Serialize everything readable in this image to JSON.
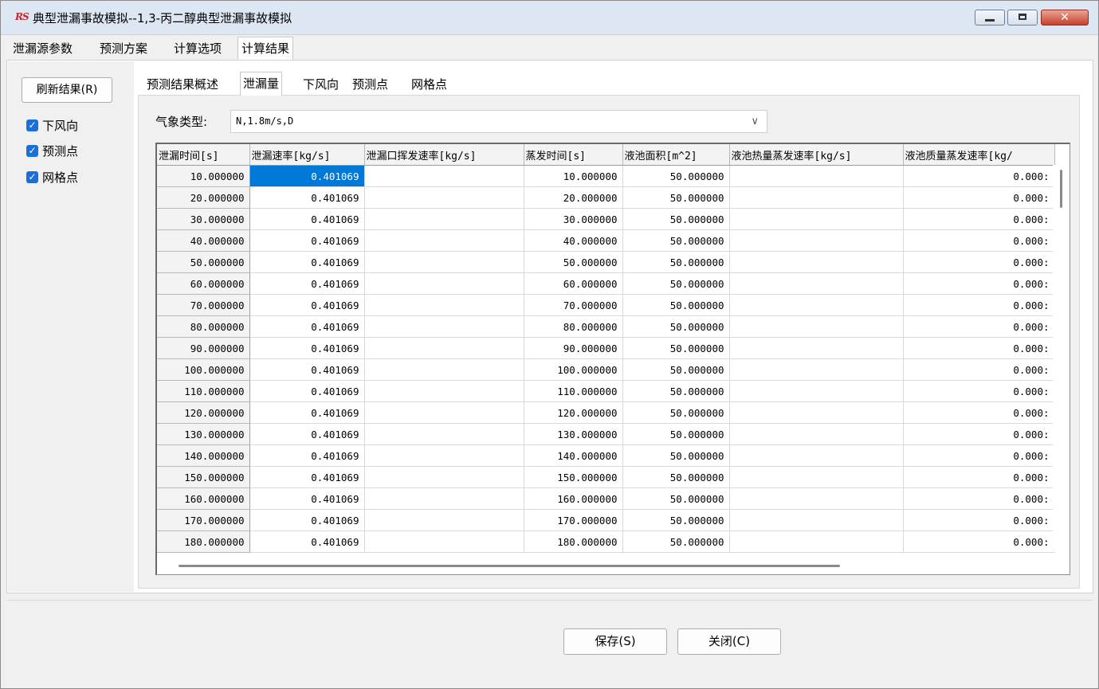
{
  "window": {
    "app_icon": "RS",
    "title": "典型泄漏事故模拟--1,3-丙二醇典型泄漏事故模拟",
    "controls": {
      "minimize": "minimize-icon",
      "maximize": "maximize-icon",
      "close": "✕"
    }
  },
  "top_tabs": [
    {
      "label": "泄漏源参数",
      "active": false
    },
    {
      "label": "预测方案",
      "active": false
    },
    {
      "label": "计算选项",
      "active": false
    },
    {
      "label": "计算结果",
      "active": true
    }
  ],
  "left": {
    "refresh_label": "刷新结果(R)",
    "checkboxes": [
      {
        "label": "下风向",
        "checked": true
      },
      {
        "label": "预测点",
        "checked": true
      },
      {
        "label": "网格点",
        "checked": true
      }
    ],
    "check_glyph": "✓"
  },
  "sub_tabs": [
    {
      "label": "预测结果概述",
      "active": false
    },
    {
      "label": "泄漏量",
      "active": true
    },
    {
      "label": "下风向",
      "active": false
    },
    {
      "label": "预测点",
      "active": false
    },
    {
      "label": "网格点",
      "active": false
    }
  ],
  "weather": {
    "label": "气象类型:",
    "value": "N,1.8m/s,D",
    "chevron": "∨"
  },
  "grid": {
    "columns": [
      "泄漏时间[s]",
      "泄漏速率[kg/s]",
      "泄漏口挥发速率[kg/s]",
      "蒸发时间[s]",
      "液池面积[m^2]",
      "液池热量蒸发速率[kg/s]",
      "液池质量蒸发速率[kg/"
    ],
    "rows": [
      [
        "10.000000",
        "0.401069",
        "",
        "10.000000",
        "50.000000",
        "",
        "0.000:"
      ],
      [
        "20.000000",
        "0.401069",
        "",
        "20.000000",
        "50.000000",
        "",
        "0.000:"
      ],
      [
        "30.000000",
        "0.401069",
        "",
        "30.000000",
        "50.000000",
        "",
        "0.000:"
      ],
      [
        "40.000000",
        "0.401069",
        "",
        "40.000000",
        "50.000000",
        "",
        "0.000:"
      ],
      [
        "50.000000",
        "0.401069",
        "",
        "50.000000",
        "50.000000",
        "",
        "0.000:"
      ],
      [
        "60.000000",
        "0.401069",
        "",
        "60.000000",
        "50.000000",
        "",
        "0.000:"
      ],
      [
        "70.000000",
        "0.401069",
        "",
        "70.000000",
        "50.000000",
        "",
        "0.000:"
      ],
      [
        "80.000000",
        "0.401069",
        "",
        "80.000000",
        "50.000000",
        "",
        "0.000:"
      ],
      [
        "90.000000",
        "0.401069",
        "",
        "90.000000",
        "50.000000",
        "",
        "0.000:"
      ],
      [
        "100.000000",
        "0.401069",
        "",
        "100.000000",
        "50.000000",
        "",
        "0.000:"
      ],
      [
        "110.000000",
        "0.401069",
        "",
        "110.000000",
        "50.000000",
        "",
        "0.000:"
      ],
      [
        "120.000000",
        "0.401069",
        "",
        "120.000000",
        "50.000000",
        "",
        "0.000:"
      ],
      [
        "130.000000",
        "0.401069",
        "",
        "130.000000",
        "50.000000",
        "",
        "0.000:"
      ],
      [
        "140.000000",
        "0.401069",
        "",
        "140.000000",
        "50.000000",
        "",
        "0.000:"
      ],
      [
        "150.000000",
        "0.401069",
        "",
        "150.000000",
        "50.000000",
        "",
        "0.000:"
      ],
      [
        "160.000000",
        "0.401069",
        "",
        "160.000000",
        "50.000000",
        "",
        "0.000:"
      ],
      [
        "170.000000",
        "0.401069",
        "",
        "170.000000",
        "50.000000",
        "",
        "0.000:"
      ],
      [
        "180.000000",
        "0.401069",
        "",
        "180.000000",
        "50.000000",
        "",
        "0.000:"
      ]
    ],
    "selected_cell": {
      "row": 0,
      "col": 1
    }
  },
  "footer": {
    "save_label": "保存(S)",
    "close_label": "关闭(C)"
  },
  "colors": {
    "accent": "#0078d7",
    "checkbox": "#1b6fd8",
    "titlebar": "#dde7f3"
  }
}
